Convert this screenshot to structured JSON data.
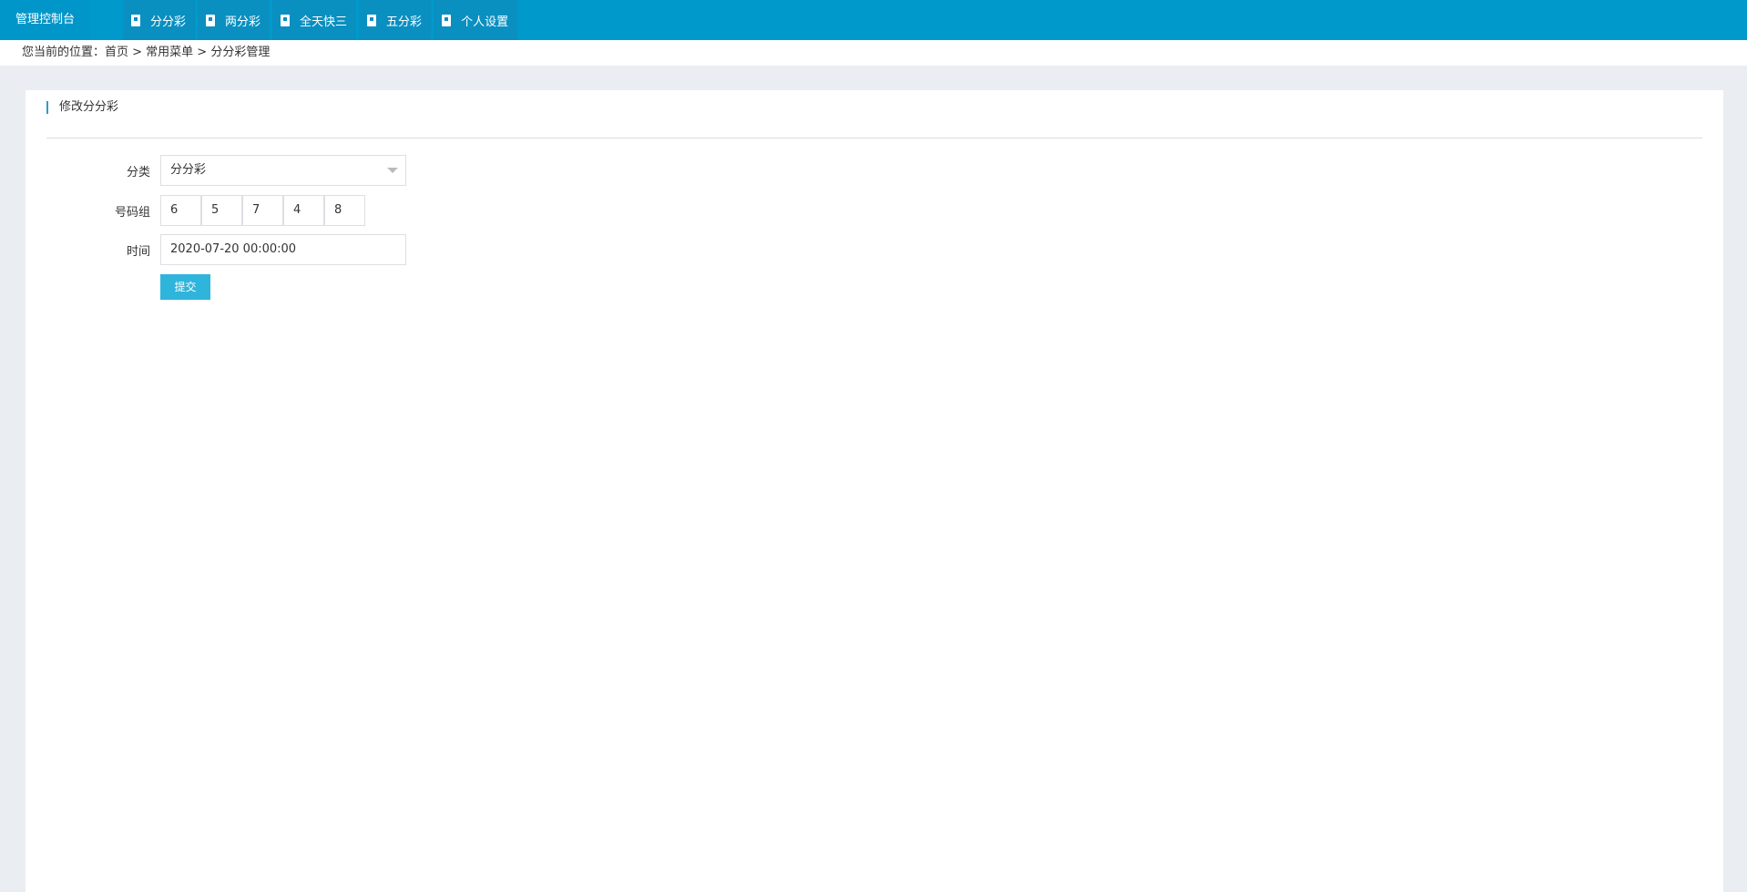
{
  "topbar": {
    "brand": "管理控制台",
    "nav": [
      {
        "label": "分分彩"
      },
      {
        "label": "两分彩"
      },
      {
        "label": "全天快三"
      },
      {
        "label": "五分彩"
      },
      {
        "label": "个人设置"
      }
    ]
  },
  "breadcrumb": "您当前的位置：首页 > 常用菜单 > 分分彩管理",
  "card": {
    "title": "修改分分彩"
  },
  "form": {
    "category_label": "分类",
    "category_value": "分分彩",
    "numbers_label": "号码组",
    "numbers": [
      "6",
      "5",
      "7",
      "4",
      "8"
    ],
    "time_label": "时间",
    "time_value": "2020-07-20 00:00:00",
    "submit_label": "提交"
  },
  "colors": {
    "topbar": "#0099cc",
    "accent": "#2fb4dc",
    "page_bg": "#eaedf1"
  }
}
